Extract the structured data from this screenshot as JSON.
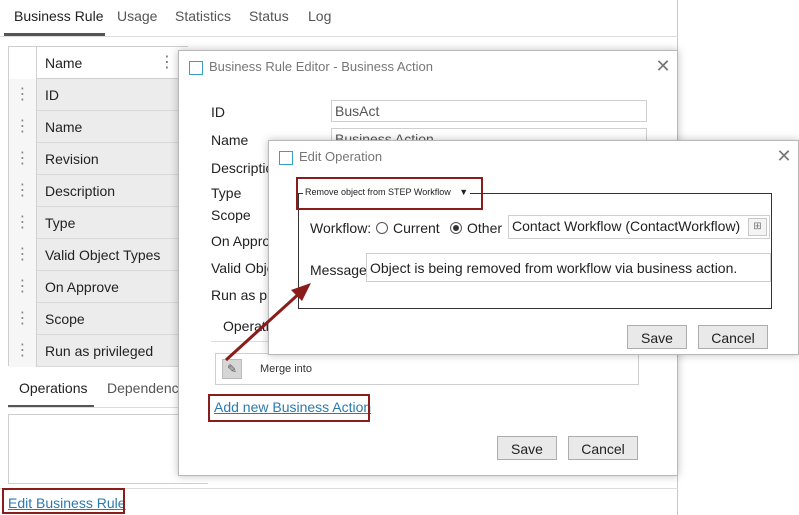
{
  "tabs": [
    "Business Rule",
    "Usage",
    "Statistics",
    "Status",
    "Log"
  ],
  "grid": {
    "header": "Name",
    "rows": [
      "ID",
      "Name",
      "Revision",
      "Description",
      "Type",
      "Valid Object Types",
      "On Approve",
      "Scope",
      "Run as privileged"
    ]
  },
  "subtabs": [
    "Operations",
    "Dependencies"
  ],
  "edit_business_rule_link": "Edit Business Rule",
  "business_action_dialog": {
    "title": "Business Rule Editor - Business Action",
    "labels": {
      "id": "ID",
      "name": "Name",
      "description": "Description",
      "type": "Type",
      "scope": "Scope",
      "on_approve": "On Approve",
      "valid_object": "Valid Object",
      "run_as": "Run as privileged"
    },
    "values": {
      "id": "BusAct",
      "name": "Business Action"
    },
    "operations_tab": "Operations",
    "operation_item": "Merge into",
    "add_new_link": "Add new Business Action",
    "save": "Save",
    "cancel": "Cancel"
  },
  "edit_operation_dialog": {
    "title": "Edit Operation",
    "operation_select": "Remove object from STEP Workflow",
    "workflow_label": "Workflow:",
    "radio_current": "Current",
    "radio_other": "Other",
    "workflow_value": "Contact Workflow (ContactWorkflow)",
    "message_label": "Message:",
    "message_value": "Object is being removed from workflow via business action.",
    "save": "Save",
    "cancel": "Cancel"
  },
  "colors": {
    "annotation_red": "#8a1c1c",
    "link_blue": "#2a7ab0",
    "dialog_icon": "#3a9ec0"
  }
}
